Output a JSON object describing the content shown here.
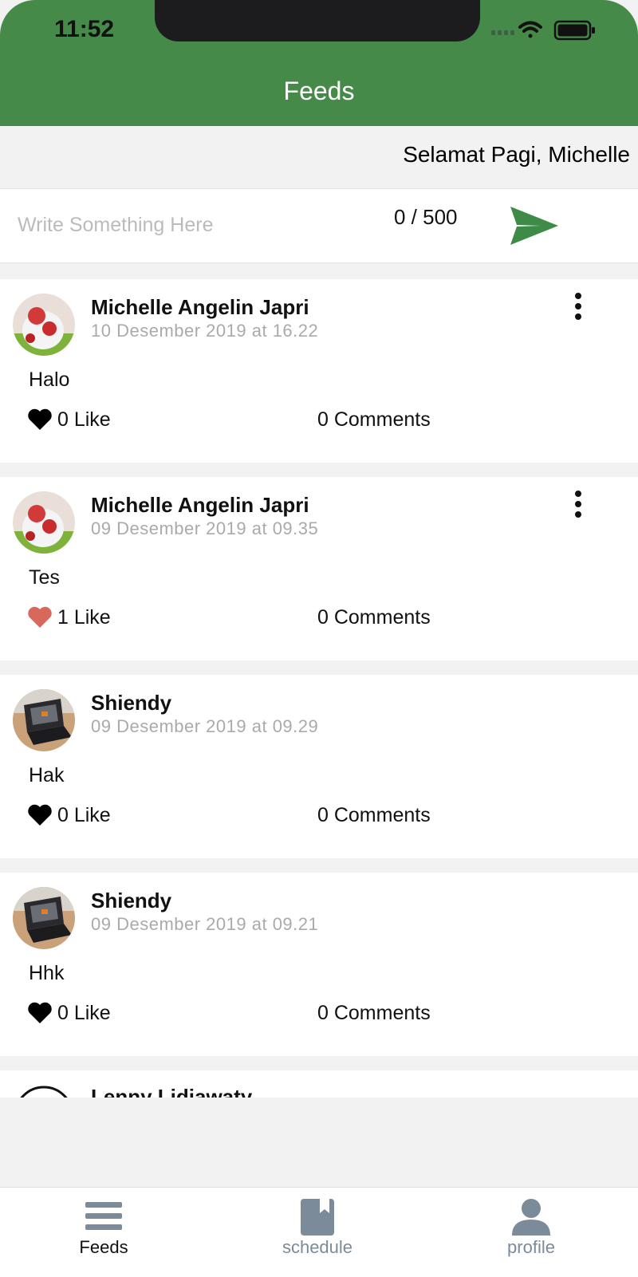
{
  "status_bar": {
    "time": "11:52"
  },
  "header": {
    "title": "Feeds"
  },
  "greeting": "Selamat Pagi, Michelle",
  "composer": {
    "placeholder": "Write Something Here",
    "counter": "0 / 500"
  },
  "posts": [
    {
      "author": "Michelle Angelin Japri",
      "date": "10 Desember 2019 at 16.22",
      "text": "Halo",
      "likes": "0 Like",
      "comments": "0 Comments",
      "liked": false,
      "avatar": "plush-toy"
    },
    {
      "author": "Michelle Angelin Japri",
      "date": "09 Desember 2019 at 09.35",
      "text": "Tes",
      "likes": "1 Like",
      "comments": "0 Comments",
      "liked": true,
      "avatar": "plush-toy"
    },
    {
      "author": "Shiendy",
      "date": "09 Desember 2019 at 09.29",
      "text": "Hak",
      "likes": "0 Like",
      "comments": "0 Comments",
      "liked": false,
      "avatar": "laptop"
    },
    {
      "author": "Shiendy",
      "date": "09 Desember 2019 at 09.21",
      "text": "Hhk",
      "likes": "0 Like",
      "comments": "0 Comments",
      "liked": false,
      "avatar": "laptop"
    },
    {
      "author": "Lenny Lidiawaty"
    }
  ],
  "tabs": [
    {
      "label": "Feeds",
      "icon": "feed-list-icon",
      "active": true
    },
    {
      "label": "schedule",
      "icon": "book-icon",
      "active": false
    },
    {
      "label": "profile",
      "icon": "person-icon",
      "active": false
    }
  ],
  "colors": {
    "header": "#468a4a",
    "send": "#3e8b48",
    "liked_heart": "#d9685c",
    "tab_active": "#111111",
    "tab_inactive": "#7c8b99"
  }
}
